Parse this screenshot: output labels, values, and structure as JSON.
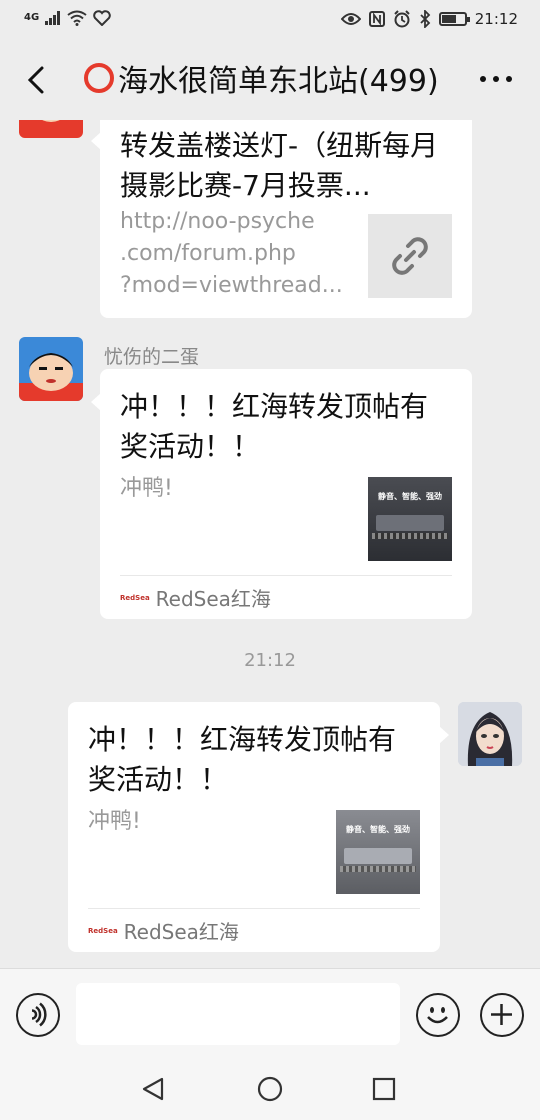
{
  "status_bar": {
    "signal_label": "4G",
    "time": "21:12",
    "left_icons": [
      "signal-icon",
      "wifi-icon",
      "heart-icon"
    ],
    "right_icons": [
      "eye-icon",
      "nfc-icon",
      "alarm-icon",
      "bluetooth-icon",
      "battery-icon"
    ]
  },
  "header": {
    "title": "海水很简单东北站(499)",
    "back_icon": "back-arrow-icon",
    "more_icon": "more-icon"
  },
  "messages": [
    {
      "side": "left",
      "title": "转发盖楼送灯-（纽斯每月摄影比赛-7月投票...",
      "desc_lines": [
        "http://noo-psyche",
        ".com/forum.php",
        "?mod=viewthread..."
      ],
      "thumb_icon": "link-icon"
    },
    {
      "side": "left",
      "sender": "忧伤的二蛋",
      "title_lines": [
        "冲！！！红海转发顶帖有",
        "奖活动！！"
      ],
      "desc": "冲鸭!",
      "thumb_text": "静音、智能、强劲",
      "source_logo": "RedSea",
      "source": "RedSea红海"
    },
    {
      "type": "timestamp",
      "text": "21:12"
    },
    {
      "side": "right",
      "title_lines": [
        "冲！！！红海转发顶帖有",
        "奖活动！！"
      ],
      "desc": "冲鸭!",
      "thumb_text": "静音、智能、强劲",
      "source_logo": "RedSea",
      "source": "RedSea红海"
    }
  ],
  "input_bar": {
    "voice_icon": "voice-icon",
    "emoji_icon": "emoji-icon",
    "plus_icon": "plus-icon",
    "placeholder": ""
  },
  "nav_bar": {
    "icons": [
      "nav-back-icon",
      "nav-home-icon",
      "nav-recents-icon"
    ]
  },
  "colors": {
    "background": "#ededed",
    "bubble": "#ffffff",
    "accent_red": "#e53a2c"
  }
}
